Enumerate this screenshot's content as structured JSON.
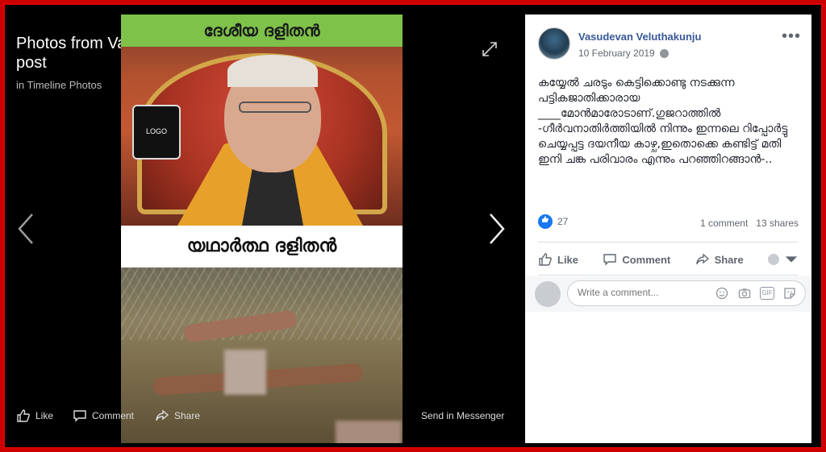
{
  "viewer": {
    "title": "Photos from Vasudevan Veluthakunju's post",
    "subtitle": "in Timeline Photos",
    "photo_top_caption": "ദേശീയ ദളിതൻ",
    "photo_logo_text": "LOGO",
    "photo_band_caption": "യഥാർത്ഥ ദളിതൻ",
    "actions": {
      "like": "Like",
      "comment": "Comment",
      "share": "Share",
      "send": "Send in Messenger"
    }
  },
  "post": {
    "author": "Vasudevan Veluthakunju",
    "date": "10 February 2019",
    "more": "•••",
    "text": "കയ്യേൽ ചരടും കെട്ടിക്കൊണ്ടു നടക്കുന്ന പട്ടികജാതിക്കാരായ ____മോൻമാരോടാണ്.ഗുജറാത്തിൽ -ഗീർവനാതിർത്തിയിൽ നിന്നും ഇന്നലെ റിപ്പോർട്ടു ചെയ്യപ്പട്ട ദയനീയ കാഴ്ച,ഇതൊക്കെ കണ്ടിട്ട് മതി ഇനി ചങ്ക പരിവാരം എന്നും പറഞ്ഞിറങ്ങാൻ-..",
    "reaction_count": "27",
    "comments_count": "1 comment",
    "shares_count": "13 shares",
    "like_label": "Like",
    "comment_label": "Comment",
    "share_label": "Share",
    "comment_placeholder": "Write a comment..."
  }
}
